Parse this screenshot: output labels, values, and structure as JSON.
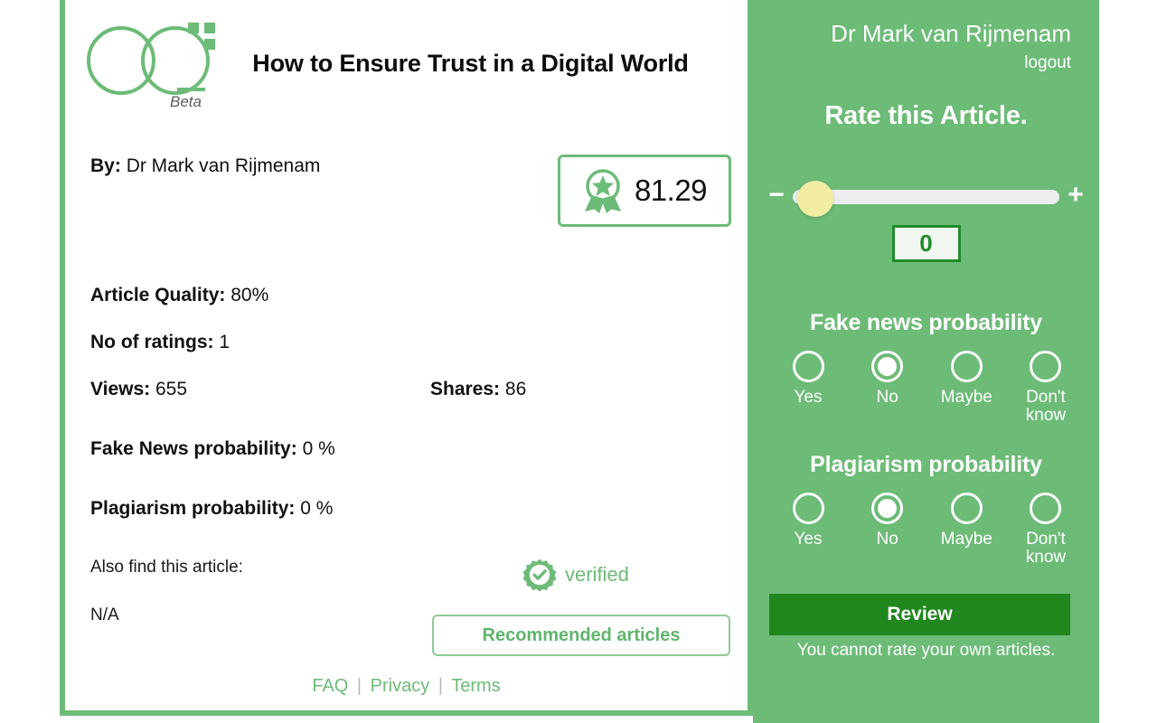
{
  "brand": {
    "logo_name": "oq-logo",
    "beta_label": "Beta",
    "accent_green": "#6cbb77",
    "dark_green": "#20871f",
    "thumb_yellow": "#f2eda2"
  },
  "article": {
    "title": "How to Ensure Trust in a Digital World",
    "by_label": "By:",
    "author": "Dr Mark van Rijmenam",
    "score": "81.29",
    "stats": [
      {
        "label": "Article Quality:",
        "value": "80%"
      },
      {
        "label": "No of ratings:",
        "value": "1"
      },
      {
        "label": "Views:",
        "value": "655"
      },
      {
        "label": "Shares:",
        "value": "86"
      },
      {
        "label": "Fake News probability:",
        "value": "0 %"
      },
      {
        "label": "Plagiarism probability:",
        "value": "0 %"
      }
    ],
    "also_find_label": "Also find this article:",
    "also_find_value": "N/A",
    "verified_label": "verified",
    "recommended_button": "Recommended articles"
  },
  "footer": {
    "faq": "FAQ",
    "privacy": "Privacy",
    "terms": "Terms",
    "separator": "|"
  },
  "rate_panel": {
    "user_name": "Dr Mark van Rijmenam",
    "logout": "logout",
    "heading": "Rate this Article.",
    "slider": {
      "minus": "−",
      "plus": "+",
      "value": "0",
      "position_percent": 0
    },
    "fake_news": {
      "title": "Fake news probability",
      "options": [
        {
          "label": "Yes",
          "checked": false
        },
        {
          "label": "No",
          "checked": true
        },
        {
          "label": "Maybe",
          "checked": false
        },
        {
          "label": "Don't know",
          "checked": false
        }
      ]
    },
    "plagiarism": {
      "title": "Plagiarism probability",
      "options": [
        {
          "label": "Yes",
          "checked": false
        },
        {
          "label": "No",
          "checked": true
        },
        {
          "label": "Maybe",
          "checked": false
        },
        {
          "label": "Don't know",
          "checked": false
        }
      ]
    },
    "review_button": "Review",
    "review_note": "You cannot rate your own articles."
  }
}
